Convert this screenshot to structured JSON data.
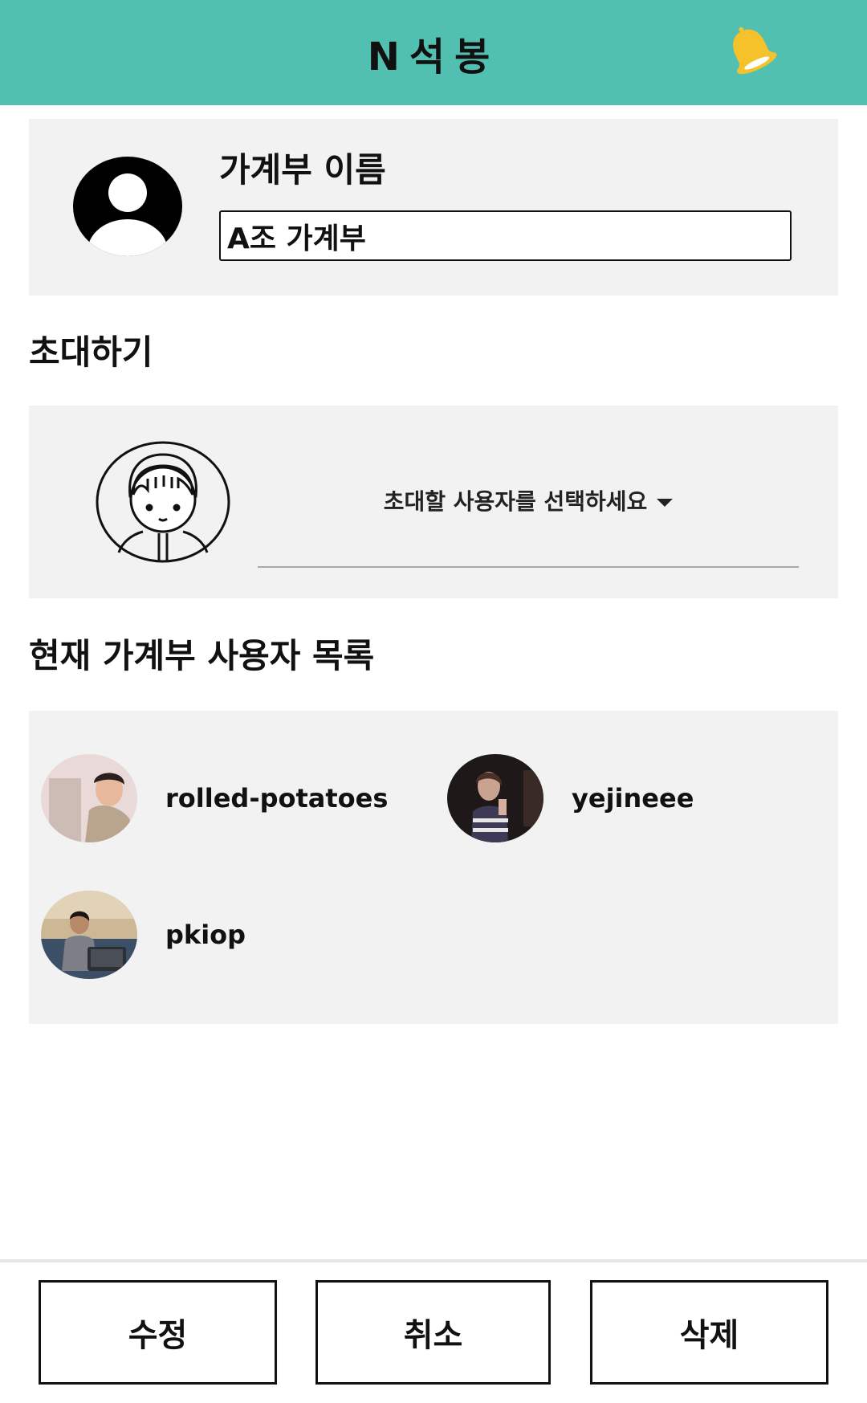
{
  "header": {
    "title": "N석봉",
    "bell_icon": "bell-icon",
    "accent_color": "#52c0b1",
    "bell_color": "#f6c22b"
  },
  "account": {
    "name_label": "가계부 이름",
    "name_value": "A조 가계부"
  },
  "invite": {
    "section_title": "초대하기",
    "select_placeholder": "초대할 사용자를 선택하세요"
  },
  "members": {
    "section_title": "현재 가계부 사용자 목록",
    "items": [
      {
        "username": "rolled-potatoes"
      },
      {
        "username": "yejineee"
      },
      {
        "username": "pkiop"
      }
    ]
  },
  "actions": {
    "edit_label": "수정",
    "cancel_label": "취소",
    "delete_label": "삭제"
  }
}
